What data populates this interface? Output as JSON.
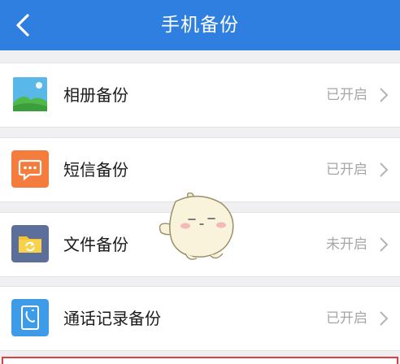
{
  "header": {
    "title": "手机备份",
    "back_icon": "chevron-left-icon",
    "background": "#2e7fe0"
  },
  "items": [
    {
      "label": "相册备份",
      "status": "已开启",
      "icon": "photo-icon",
      "icon_color": "#5ab8e8"
    },
    {
      "label": "短信备份",
      "status": "已开启",
      "icon": "message-icon",
      "icon_color": "#f47c3c"
    },
    {
      "label": "文件备份",
      "status": "未开启",
      "icon": "folder-sync-icon",
      "icon_color": "#5b6f9a"
    },
    {
      "label": "通话记录备份",
      "status": "已开启",
      "icon": "call-log-icon",
      "icon_color": "#3d9be8"
    }
  ]
}
